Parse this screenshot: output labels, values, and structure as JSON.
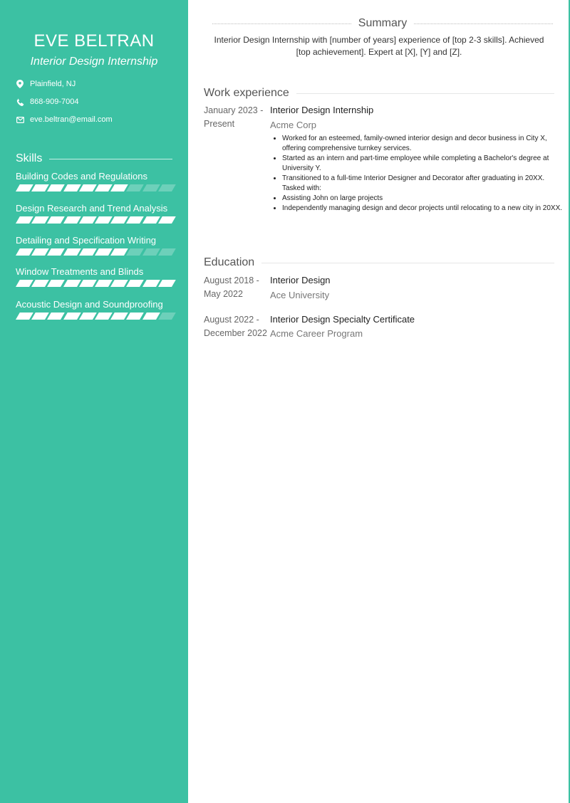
{
  "profile": {
    "name": "EVE BELTRAN",
    "title": "Interior Design Internship",
    "contacts": [
      {
        "icon": "map-pin-icon",
        "text": "Plainfield, NJ"
      },
      {
        "icon": "phone-icon",
        "text": "868-909-7004"
      },
      {
        "icon": "envelope-icon",
        "text": "eve.beltran@email.com"
      }
    ]
  },
  "skills": {
    "heading": "Skills",
    "max_level": 10,
    "items": [
      {
        "label": "Building Codes and Regulations",
        "level": 7
      },
      {
        "label": "Design Research and Trend Analysis",
        "level": 10
      },
      {
        "label": "Detailing and Specification Writing",
        "level": 7
      },
      {
        "label": "Window Treatments and Blinds",
        "level": 10
      },
      {
        "label": "Acoustic Design and Soundproofing",
        "level": 9
      }
    ]
  },
  "summary": {
    "heading": "Summary",
    "text": "Interior Design Internship with [number of years] experience of [top 2-3 skills]. Achieved [top achievement]. Expert at [X], [Y] and [Z]."
  },
  "work": {
    "heading": "Work experience",
    "items": [
      {
        "date_start": "January 2023 -",
        "date_end": "Present",
        "role": "Interior Design Internship",
        "company": "Acme Corp",
        "bullets": [
          "Worked for an esteemed, family-owned interior design and decor business in City X, offering comprehensive turnkey services.",
          "Started as an intern and part-time employee while completing a Bachelor's degree at University Y.",
          "Transitioned to a full-time Interior Designer and Decorator after graduating in 20XX. Tasked with:",
          "Assisting John on large projects",
          "Independently managing design and decor projects until relocating to a new city in 20XX."
        ]
      }
    ]
  },
  "education": {
    "heading": "Education",
    "items": [
      {
        "date_start": "August 2018 -",
        "date_end": "May 2022",
        "degree": "Interior Design",
        "school": "Ace University"
      },
      {
        "date_start": "August 2022 -",
        "date_end": "December 2022",
        "degree": "Interior Design Specialty Certificate",
        "school": "Acme Career Program"
      }
    ]
  },
  "colors": {
    "accent": "#3cc1a3"
  }
}
